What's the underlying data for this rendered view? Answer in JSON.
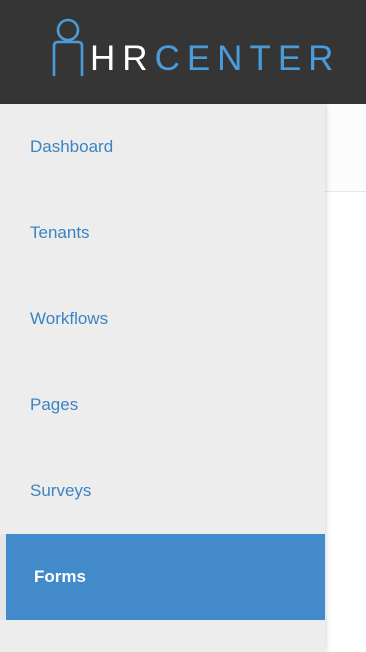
{
  "header": {
    "logo_hr": "HR",
    "logo_center": "CENTER",
    "accent_color": "#4b9bd9",
    "background_color": "#353535"
  },
  "sidebar": {
    "active_color": "#438acb",
    "items": [
      {
        "label": "Dashboard",
        "active": false
      },
      {
        "label": "Tenants",
        "active": false
      },
      {
        "label": "Workflows",
        "active": false
      },
      {
        "label": "Pages",
        "active": false
      },
      {
        "label": "Surveys",
        "active": false
      },
      {
        "label": "Forms",
        "active": true
      }
    ]
  }
}
